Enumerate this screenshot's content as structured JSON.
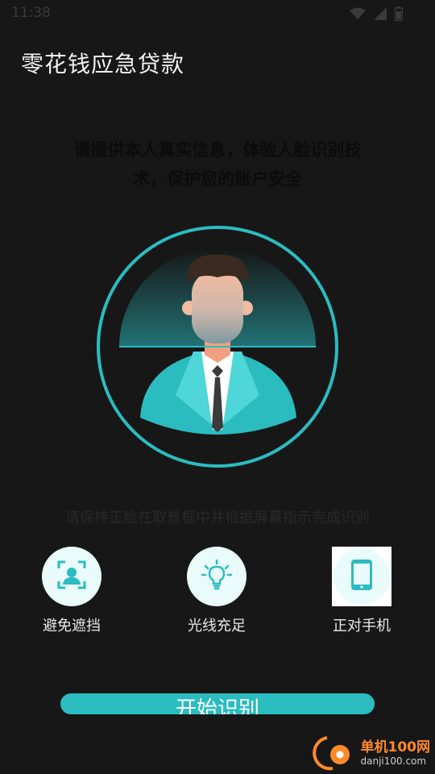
{
  "status": {
    "time": "11:38"
  },
  "app": {
    "title": "零花钱应急贷款"
  },
  "instruction": {
    "line1": "请提供本人真实信息，体验人脸识别技",
    "line2": "术，保护您的账户安全"
  },
  "hint": "请保持正脸在取景框中并根据屏幕指示完成识别",
  "tips": [
    {
      "label": "避免遮挡",
      "icon": "face-scan-icon"
    },
    {
      "label": "光线充足",
      "icon": "lightbulb-icon"
    },
    {
      "label": "正对手机",
      "icon": "phone-icon"
    }
  ],
  "start_button": {
    "label": "开始识别"
  },
  "watermark": {
    "name": "单机100网",
    "url": "danji100.com"
  },
  "colors": {
    "accent": "#2bbcc0",
    "background": "#171717"
  }
}
